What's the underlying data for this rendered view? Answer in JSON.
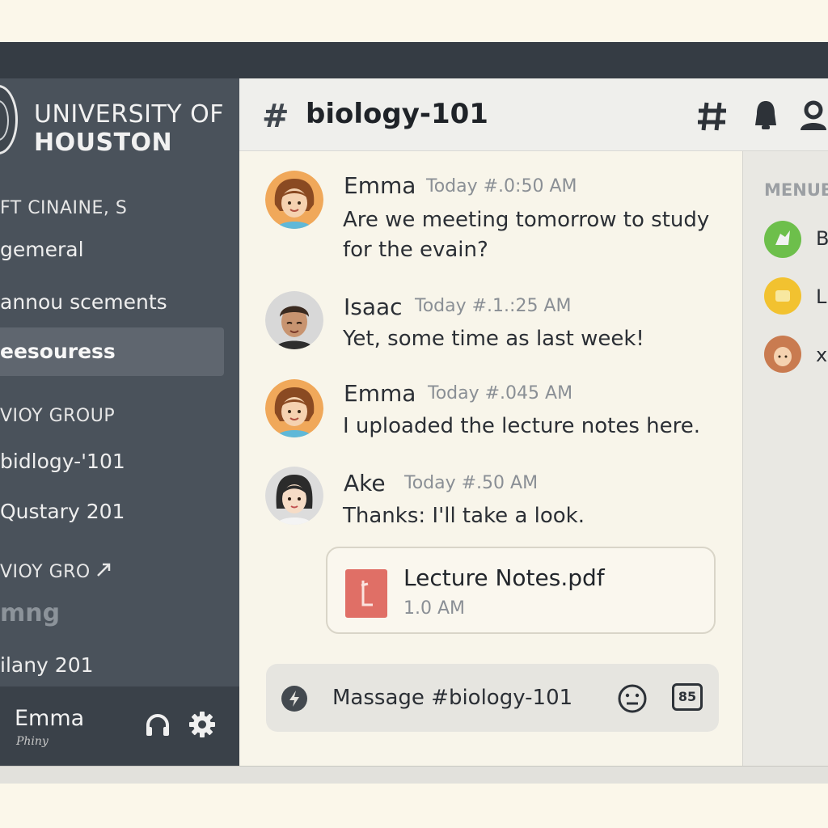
{
  "server": {
    "name_line1": "UNIVERSITY OF",
    "name_line2": "HOUSTON"
  },
  "sidebar": {
    "categories": [
      {
        "label": "FT CINAINE, S"
      },
      {
        "label": "VIOY GROUP"
      },
      {
        "label": "VIOY GRO"
      }
    ],
    "channels": [
      {
        "label": "gemeral"
      },
      {
        "label": "annou scements"
      },
      {
        "label": "eesouress",
        "active": true
      },
      {
        "label": "bidlogy-'101"
      },
      {
        "label": "Qustary 201"
      },
      {
        "label": "mng"
      },
      {
        "label": "ilany 201"
      }
    ]
  },
  "user_panel": {
    "name": "Emma",
    "status": "Phiny"
  },
  "header": {
    "channel_name": "biology-101",
    "icons": [
      "hash-icon",
      "bell-icon",
      "members-icon"
    ]
  },
  "messages": [
    {
      "author": "Emma",
      "time": "Today #.0:50 AM",
      "text_line1": "Are we meeting tomorrow to study",
      "text_line2": "for the evain?"
    },
    {
      "author": "Isaac",
      "time": "Today #.1.:25 AM",
      "text_line1": "Yet, some time as last week!"
    },
    {
      "author": "Emma",
      "time": "Today #.045 AM",
      "text_line1": "I uploaded the lecture notes here."
    },
    {
      "author": "Ake",
      "time": "Today #.50 AM",
      "text_line1": "Thanks: I'll take a look."
    }
  ],
  "attachment": {
    "filename": "Lecture Notes.pdf",
    "size": "1.0 AM"
  },
  "composer": {
    "placeholder": "Massage #biology-101",
    "gif_label": "85"
  },
  "members": {
    "header": "MENUB",
    "items": [
      {
        "name": "B",
        "color": "#6dbf4b"
      },
      {
        "name": "L",
        "color": "#f2c230"
      },
      {
        "name": "х",
        "color": "#c97b50"
      }
    ]
  },
  "colors": {
    "sidebar": "#4a525b",
    "active_channel": "#5f666f",
    "chat_bg": "#f8f5ea",
    "pdf_red": "#e06f66"
  }
}
